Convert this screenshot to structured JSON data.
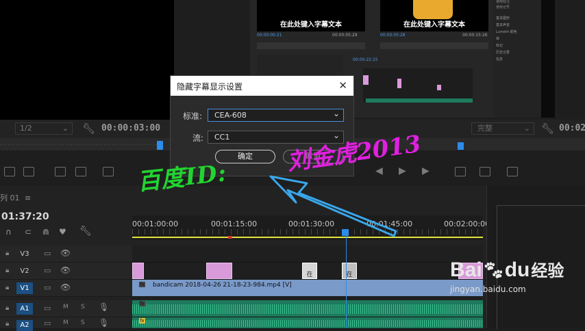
{
  "top_left": {
    "res_select": "1/2",
    "timecode": "00:00:03:00"
  },
  "top_right": {
    "quality_select": "完整",
    "timecode_partial": "00:02"
  },
  "embedded": {
    "caption_left": "在此处键入字幕文本",
    "caption_right": "在此处键入字幕文本",
    "tc_left": "00:00:00:21",
    "tc_left_end": "00:00:05:29",
    "tc_right": "00:00:05:28",
    "tc_right_end": "00:00:15:26",
    "tc_timeline": "00:00:22:15",
    "side_items": [
      "基本图形",
      "基本声音",
      "Lumetri 颜色",
      "库",
      "标记",
      "历史记录",
      "信息"
    ],
    "checkbox_items": [
      "使用标注",
      "使用记号"
    ]
  },
  "sequence": {
    "name": "列 01",
    "timecode": "01:37:20"
  },
  "ruler": {
    "labels": [
      "00:01:00:00",
      "00:01:15:00",
      "00:01:30:00",
      "00:01:45:00",
      "00:02:00:00"
    ]
  },
  "tracks": [
    {
      "name": "V3",
      "active": false
    },
    {
      "name": "V2",
      "active": false
    },
    {
      "name": "V1",
      "active": true
    },
    {
      "name": "A1",
      "active": true
    },
    {
      "name": "A2",
      "active": true
    }
  ],
  "track_letters": {
    "m": "M",
    "s": "S"
  },
  "v1_clip": "bandicam 2018-04-26 21-18-23-984.mp4 [V]",
  "clip_icon": "fx",
  "caption_marker": "在",
  "dialog": {
    "title": "隐藏字幕显示设置",
    "standard_label": "标准:",
    "standard_value": "CEA-608",
    "stream_label": "流:",
    "stream_value": "CC1",
    "ok": "确定",
    "cancel": "取消"
  },
  "overlay": {
    "text_green": "百度ID:",
    "text_magenta": "刘金虎2013",
    "arrow_color": "#3aa6e8",
    "green_color": "#22d431",
    "magenta_color": "#e020e0"
  },
  "watermark": {
    "brand_a": "Bai",
    "brand_b": "du",
    "brand_cn": "经验",
    "url": "jingyan.baidu.com"
  },
  "colors": {
    "accent_blue": "#2d8ceb",
    "playhead": "#2d8ceb",
    "track_active": "#1c4f82"
  }
}
